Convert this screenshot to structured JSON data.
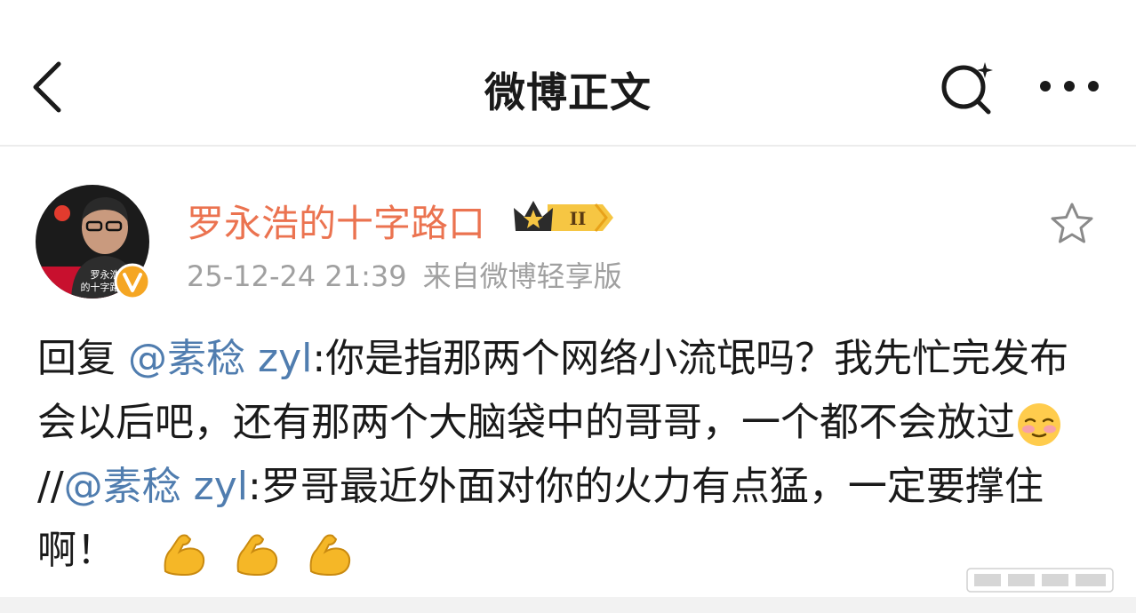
{
  "nav": {
    "title": "微博正文"
  },
  "post": {
    "author": {
      "name": "罗永浩的十字路口",
      "avatar_caption_line1": "罗永浩",
      "avatar_caption_line2": "的十字路口",
      "level": "II"
    },
    "time": "25-12-24 21:39",
    "source": "来自微博轻享版",
    "content": {
      "reply_prefix": "回复",
      "mention": "@素稔 zyl",
      "part1": ":你是指那两个网络小流氓吗？我先忙完发布会以后吧，还有那两个大脑袋中的哥哥，一个都不会放过",
      "repost_sep": "//",
      "part2": ":罗哥最近外面对你的火力有点猛，一定要撑住啊！"
    },
    "icons": {
      "shy_emoji": "shy-blush-emoji-icon",
      "muscle_emoji": "flexed-biceps-emoji-icon",
      "verified": "verified-badge-icon",
      "favorite": "star-outline-icon"
    }
  },
  "colors": {
    "username": "#eb7350",
    "mention": "#507daf",
    "meta": "#a0a0a0",
    "badge": "#f5a623"
  }
}
